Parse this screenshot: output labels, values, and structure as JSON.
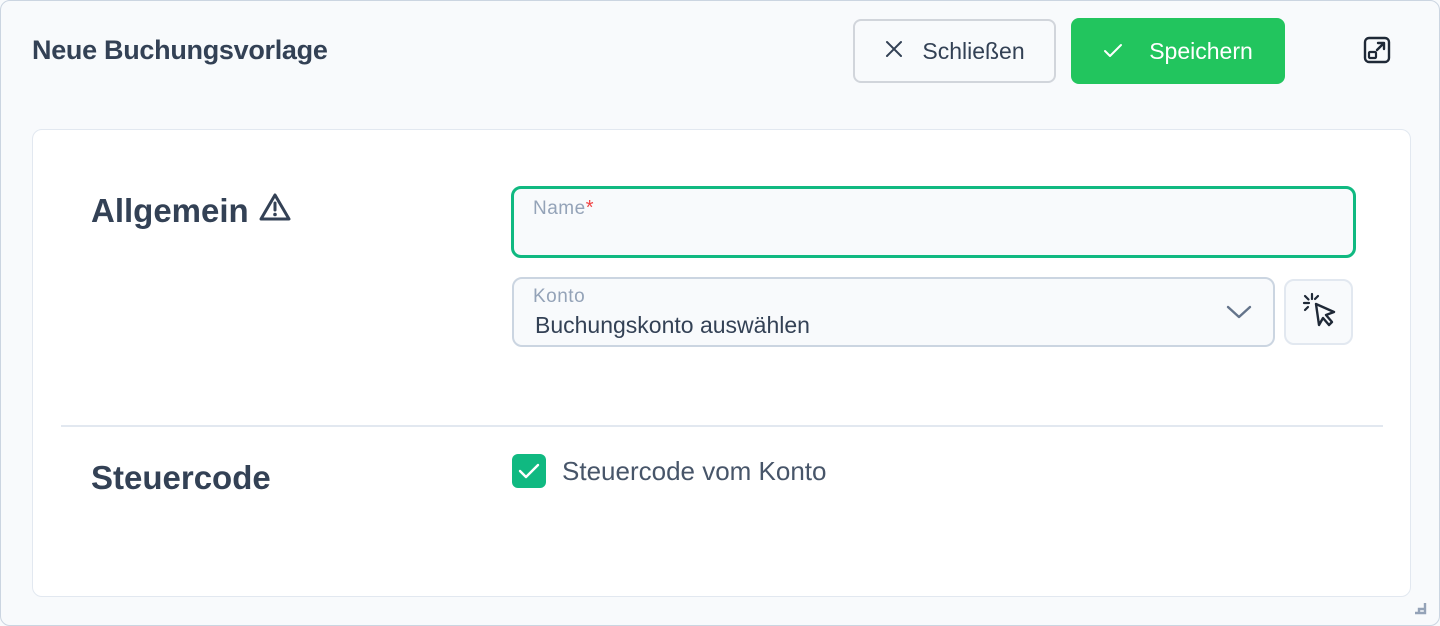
{
  "header": {
    "title": "Neue Buchungsvorlage",
    "close_label": "Schließen",
    "save_label": "Speichern"
  },
  "sections": {
    "allgemein": {
      "title": "Allgemein",
      "name_field": {
        "label": "Name",
        "required_mark": "*",
        "value": ""
      },
      "konto_field": {
        "label": "Konto",
        "value": "Buchungskonto auswählen"
      }
    },
    "steuercode": {
      "title": "Steuercode",
      "checkbox_label": "Steuercode vom Konto",
      "checked": true
    }
  },
  "colors": {
    "accent": "#22c55e",
    "focus": "#10b981",
    "required": "#ef4444",
    "text": "#334155"
  },
  "icons": [
    "close-icon",
    "check-icon",
    "expand-icon",
    "warning-icon",
    "chevron-down-icon",
    "pointer-select-icon",
    "resize-grip-icon"
  ]
}
